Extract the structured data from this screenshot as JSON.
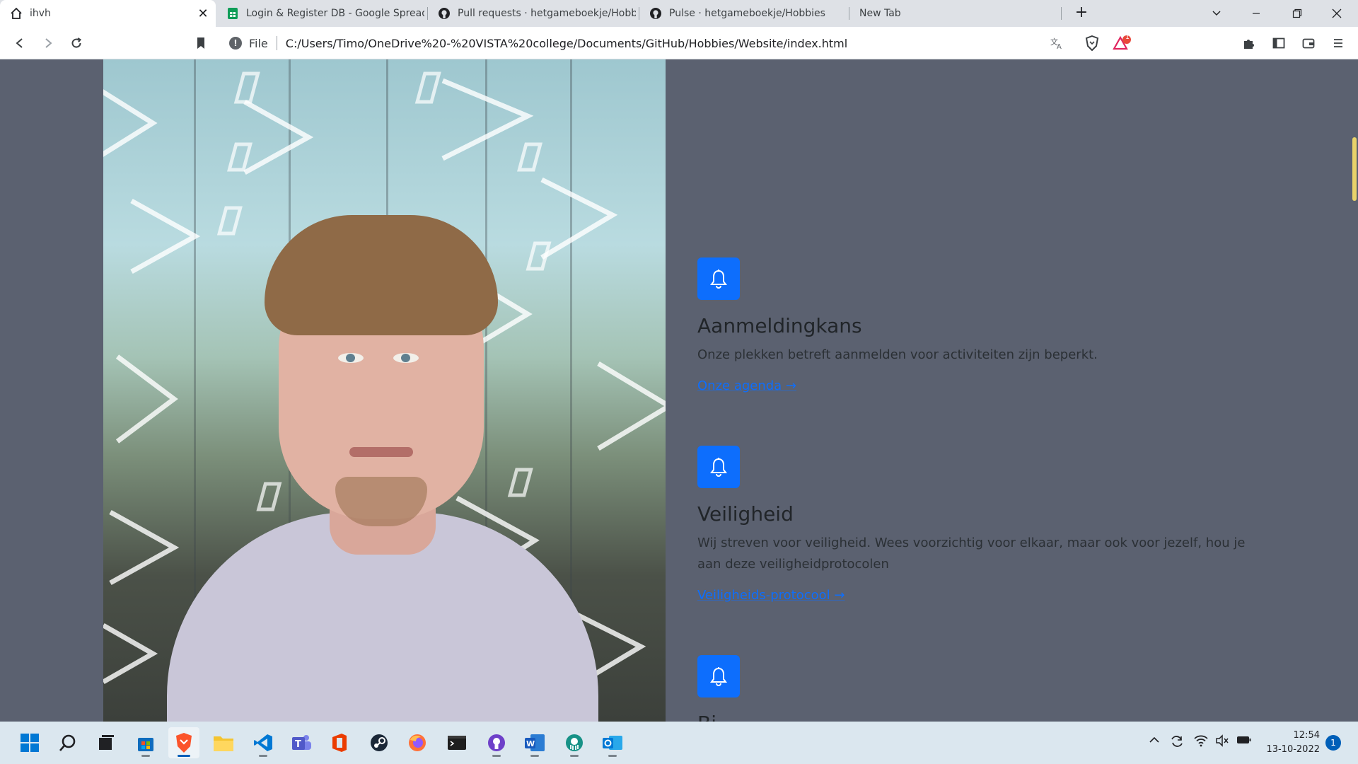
{
  "browser": {
    "tabs": [
      {
        "title": "ihvh",
        "icon": "home-icon",
        "active": true,
        "close": "✕"
      },
      {
        "title": "Login & Register DB - Google Spreads",
        "icon": "google-sheets-icon",
        "active": false
      },
      {
        "title": "Pull requests · hetgameboekje/Hobbie",
        "icon": "github-icon",
        "active": false
      },
      {
        "title": "Pulse · hetgameboekje/Hobbies",
        "icon": "github-icon",
        "active": false
      },
      {
        "title": "New Tab",
        "icon": "",
        "active": false
      }
    ],
    "new_tab_label": "+",
    "address": {
      "scheme_label": "File",
      "url": "C:/Users/Timo/OneDrive%20-%20VISTA%20college/Documents/GitHub/Hobbies/Website/index.html"
    },
    "brave_rewards_count": "1"
  },
  "page": {
    "features": [
      {
        "icon": "bell-icon",
        "title": "Aanmeldingkans",
        "text": "Onze plekken betreft aanmelden voor activiteiten zijn beperkt.",
        "link": "Onze agenda →"
      },
      {
        "icon": "bell-icon",
        "title": "Veiligheid",
        "text": "Wij streven voor veiligheid. Wees voorzichtig voor elkaar, maar ook voor jezelf, hou je aan deze veiligheidprotocolen",
        "link": "Veiligheids-protocool →"
      },
      {
        "icon": "bell-icon",
        "title": "Bi...",
        "text": "",
        "link": ""
      }
    ]
  },
  "taskbar": {
    "apps": [
      "start-icon",
      "search-icon",
      "task-view-icon",
      "store-icon",
      "brave-icon",
      "file-explorer-icon",
      "vscode-icon",
      "teams-icon",
      "office-icon",
      "steam-icon",
      "firefox-icon",
      "terminal-icon",
      "github-desktop-icon",
      "word-icon",
      "gitkraken-icon",
      "outlook-icon"
    ],
    "clock": {
      "time": "12:54",
      "date": "13-10-2022"
    },
    "notification_count": "1"
  },
  "colors": {
    "page_background": "#5b6170",
    "accent": "#0d6efd",
    "taskbar": "#dbe7ef"
  }
}
